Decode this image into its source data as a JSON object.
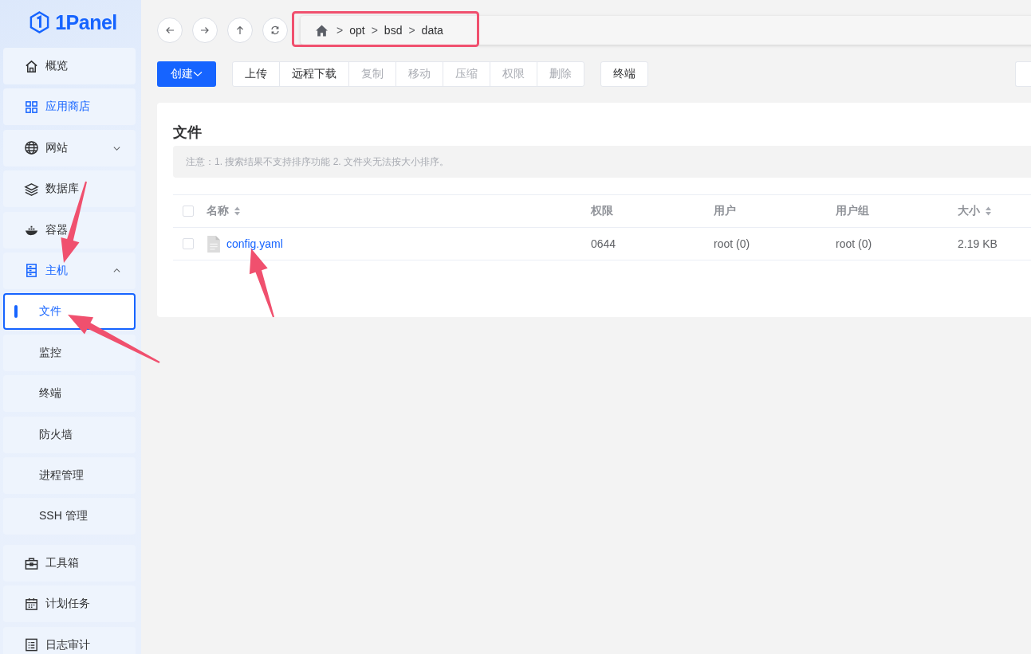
{
  "logo": {
    "text": "1Panel"
  },
  "sidebar": {
    "items": [
      {
        "kind": "menu",
        "label": "概览",
        "highlighted": false
      },
      {
        "kind": "menu",
        "label": "应用商店",
        "highlighted": true
      },
      {
        "kind": "group",
        "label": "网站",
        "highlighted": false,
        "expanded": false
      },
      {
        "kind": "menu",
        "label": "数据库",
        "highlighted": false
      },
      {
        "kind": "menu",
        "label": "容器",
        "highlighted": false
      },
      {
        "kind": "group",
        "label": "主机",
        "highlighted": true,
        "expanded": true,
        "children": [
          {
            "label": "文件",
            "selected": true
          },
          {
            "label": "监控",
            "selected": false
          },
          {
            "label": "终端",
            "selected": false
          },
          {
            "label": "防火墙",
            "selected": false
          },
          {
            "label": "进程管理",
            "selected": false
          },
          {
            "label": "SSH 管理",
            "selected": false
          }
        ]
      },
      {
        "kind": "menu",
        "label": "工具箱",
        "highlighted": false
      },
      {
        "kind": "menu",
        "label": "计划任务",
        "highlighted": false
      },
      {
        "kind": "menu",
        "label": "日志审计",
        "highlighted": false
      }
    ]
  },
  "breadcrumb": [
    {
      "separator": ">",
      "label": "opt"
    },
    {
      "separator": ">",
      "label": "bsd"
    },
    {
      "separator": ">",
      "label": "data"
    }
  ],
  "toolbar": {
    "create": {
      "label": "创建"
    },
    "groups": [
      [
        {
          "label": "上传",
          "disabled": false
        },
        {
          "label": "远程下载",
          "disabled": false
        },
        {
          "label": "复制",
          "disabled": true
        },
        {
          "label": "移动",
          "disabled": true
        },
        {
          "label": "压缩",
          "disabled": true
        },
        {
          "label": "权限",
          "disabled": true
        },
        {
          "label": "删除",
          "disabled": true
        }
      ],
      [
        {
          "label": "终端",
          "disabled": false
        }
      ]
    ]
  },
  "card": {
    "title": "文件",
    "notice": "注意：1. 搜索结果不支持排序功能 2. 文件夹无法按大小排序。"
  },
  "table": {
    "select_all_checked": false,
    "columns": [
      {
        "label": "名称",
        "sortable": true
      },
      {
        "label": "权限",
        "sortable": false
      },
      {
        "label": "用户",
        "sortable": false
      },
      {
        "label": "用户组",
        "sortable": false
      },
      {
        "label": "大小",
        "sortable": true
      }
    ],
    "rows": [
      {
        "checked": false,
        "name": "config.yaml",
        "permission": "0644",
        "user": "root (0)",
        "group": "root (0)",
        "size": "2.19 KB"
      }
    ]
  }
}
